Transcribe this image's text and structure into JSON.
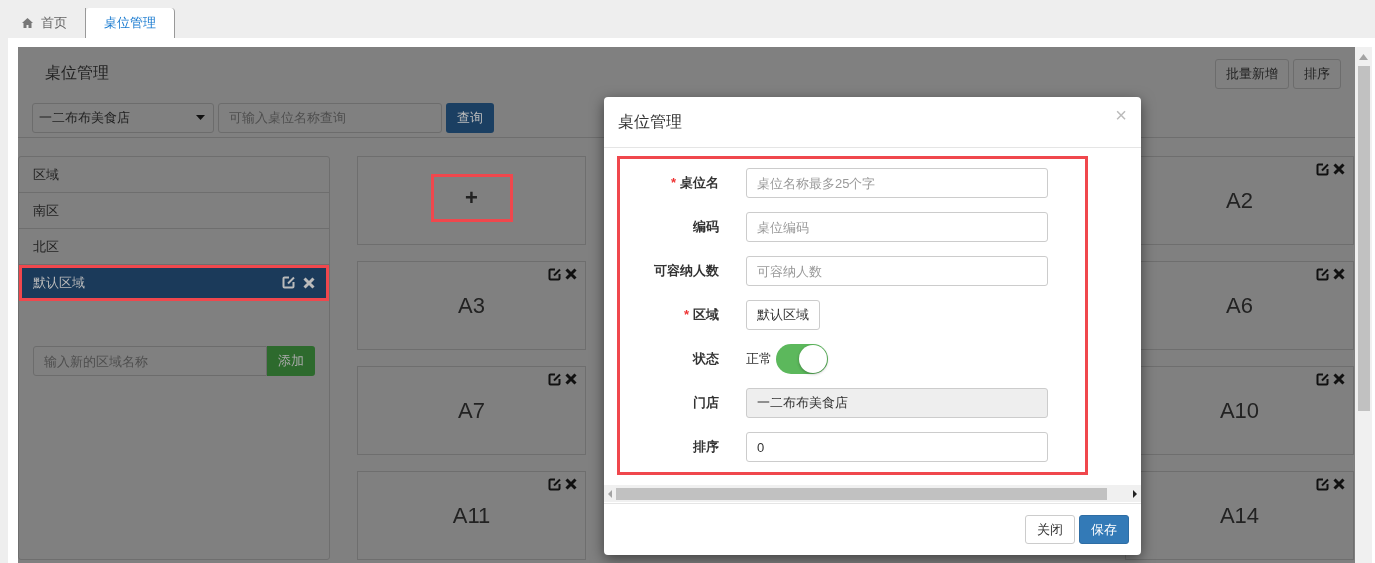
{
  "tabs": [
    {
      "label": "首页",
      "kind": "home",
      "selected": false
    },
    {
      "label": "桌位管理",
      "selected": true
    }
  ],
  "page": {
    "title": "桌位管理",
    "buttons": [
      "批量新增",
      "排序"
    ],
    "store_select": {
      "value": "一二布布美食店"
    },
    "search": {
      "placeholder": "可输入桌位名称查询"
    },
    "search_button": "查询"
  },
  "areas": {
    "header": "区域",
    "items": [
      {
        "label": "南区",
        "selected": false,
        "highlighted": false
      },
      {
        "label": "北区",
        "selected": false,
        "highlighted": false
      },
      {
        "label": "默认区域",
        "selected": true,
        "highlighted": true
      }
    ],
    "new_area": {
      "placeholder": "输入新的区域名称"
    },
    "add_button": "添加"
  },
  "card_rows": [
    [
      {
        "kind": "add",
        "label": "+",
        "highlighted": true
      },
      {
        "kind": "table",
        "label": "A2"
      }
    ],
    [
      {
        "kind": "table",
        "label": "A3"
      },
      {
        "kind": "table",
        "label": "A6"
      }
    ],
    [
      {
        "kind": "table",
        "label": "A7"
      },
      {
        "kind": "table",
        "label": "A10"
      }
    ],
    [
      {
        "kind": "table",
        "label": "A11"
      },
      {
        "kind": "table",
        "label": "A14"
      }
    ]
  ],
  "modal": {
    "title": "桌位管理",
    "close": "×",
    "highlighted": true,
    "required_mark": "*",
    "fields": [
      {
        "kind": "input",
        "label": "桌位名",
        "required": true,
        "placeholder": "桌位名称最多25个字"
      },
      {
        "kind": "input",
        "label": "编码",
        "required": false,
        "placeholder": "桌位编码"
      },
      {
        "kind": "input",
        "label": "可容纳人数",
        "required": false,
        "placeholder": "可容纳人数"
      },
      {
        "kind": "choice",
        "label": "区域",
        "required": true,
        "value": "默认区域"
      },
      {
        "kind": "switch",
        "label": "状态",
        "required": false,
        "value": "正常",
        "on": true
      },
      {
        "kind": "input",
        "label": "门店",
        "required": false,
        "value": "一二布布美食店",
        "disabled": true
      },
      {
        "kind": "input",
        "label": "排序",
        "required": false,
        "value": "0",
        "disabled": false
      }
    ],
    "buttons": [
      {
        "label": "关闭",
        "kind": "default"
      },
      {
        "label": "保存",
        "kind": "primary"
      }
    ]
  }
}
